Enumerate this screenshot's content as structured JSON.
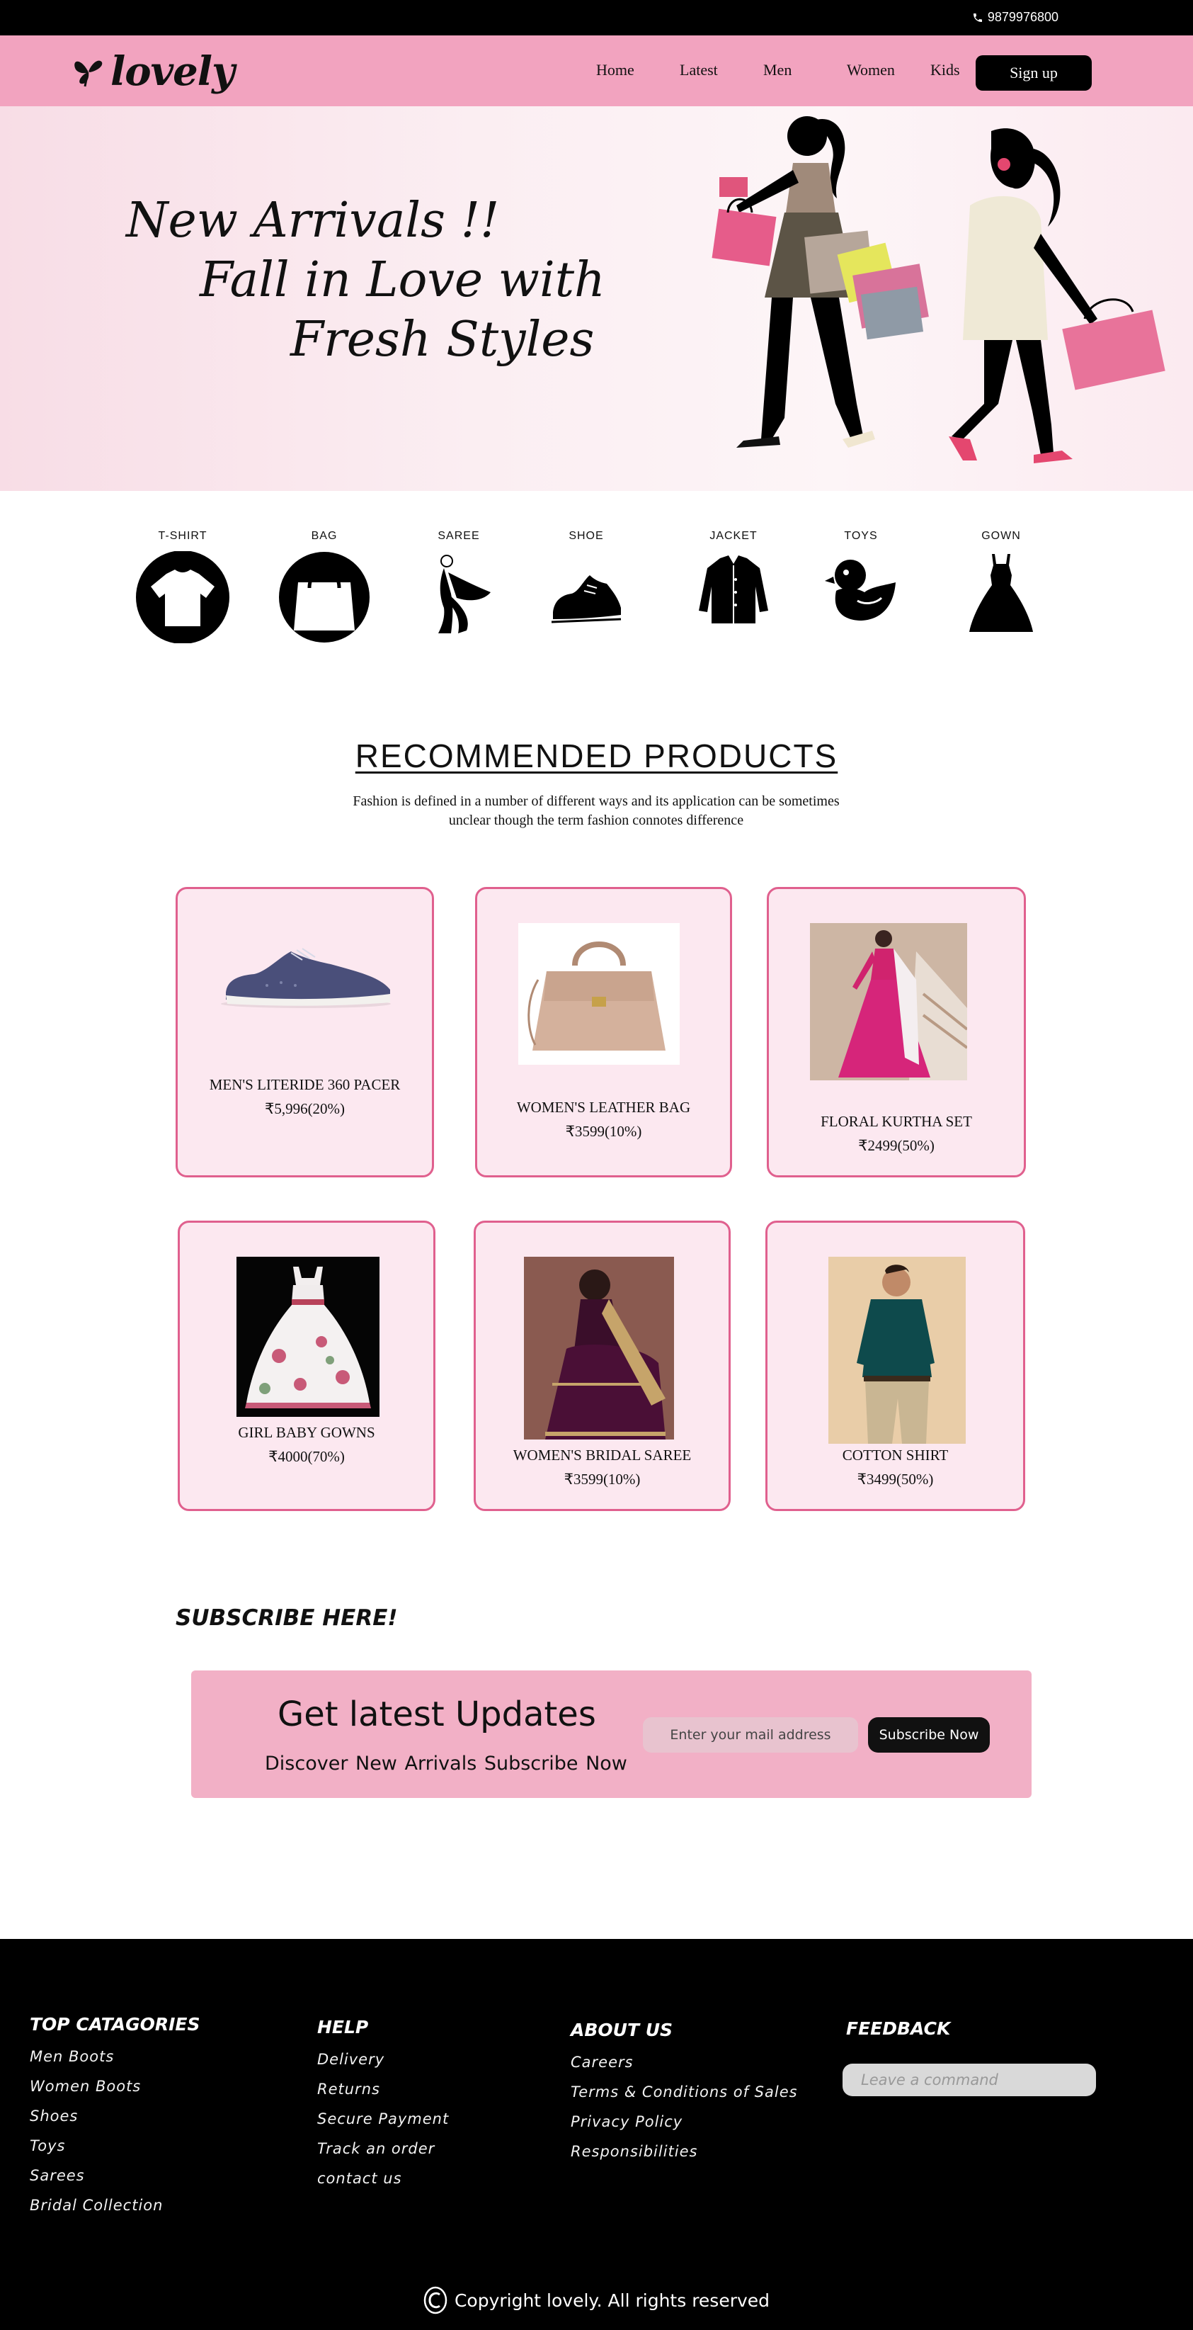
{
  "topbar": {
    "phone": "9879976800"
  },
  "brand": {
    "name": "lovely",
    "pink": "#f2a3bf",
    "card_border": "#e0608e",
    "card_bg": "#fce8f0"
  },
  "nav": {
    "links": [
      "Home",
      "Latest",
      "Men",
      "Women",
      "Kids"
    ],
    "signup": "Sign up"
  },
  "hero": {
    "line1": "New Arrivals !!",
    "line2": "Fall in Love with",
    "line3": "Fresh Styles"
  },
  "categories": [
    {
      "label": "T-SHIRT",
      "icon": "tshirt-icon"
    },
    {
      "label": "BAG",
      "icon": "bag-icon"
    },
    {
      "label": "SAREE",
      "icon": "saree-icon"
    },
    {
      "label": "SHOE",
      "icon": "shoe-icon"
    },
    {
      "label": "JACKET",
      "icon": "jacket-icon"
    },
    {
      "label": "TOYS",
      "icon": "duck-icon"
    },
    {
      "label": "GOWN",
      "icon": "gown-icon"
    }
  ],
  "recommended": {
    "title": "RECOMMENDED PRODUCTS",
    "subtitle": "Fashion is defined in a number of different ways and its application can be sometimes unclear though the term fashion connotes difference",
    "products": [
      {
        "name": "MEN'S LITERIDE 360 PACER",
        "price": "₹5,996(20%)"
      },
      {
        "name": "WOMEN'S LEATHER BAG",
        "price": "₹3599(10%)"
      },
      {
        "name": "FLORAL KURTHA SET",
        "price": "₹2499(50%)"
      },
      {
        "name": "GIRL BABY GOWNS",
        "price": "₹4000(70%)"
      },
      {
        "name": "WOMEN'S BRIDAL SAREE",
        "price": "₹3599(10%)"
      },
      {
        "name": "COTTON SHIRT",
        "price": "₹3499(50%)"
      }
    ]
  },
  "subscribe": {
    "heading": "SUBSCRIBE HERE!",
    "title": "Get latest Updates",
    "line": "Discover New Arrivals  Subscribe Now",
    "placeholder": "Enter your mail address",
    "button": "Subscribe Now"
  },
  "footer": {
    "categories": {
      "title": "TOP CATAGORIES",
      "links": [
        "Men Boots",
        "Women Boots",
        "Shoes",
        "Toys",
        "Sarees",
        "Bridal Collection"
      ]
    },
    "help": {
      "title": "HELP",
      "links": [
        "Delivery",
        "Returns",
        "Secure Payment",
        "Track an order",
        "contact us"
      ]
    },
    "about": {
      "title": "ABOUT US",
      "links": [
        "Careers",
        "Terms & Conditions of Sales",
        "Privacy Policy",
        "Responsibilities"
      ]
    },
    "feedback": {
      "title": "FEEDBACK",
      "placeholder": "Leave a command"
    },
    "copyright": "Copyright lovely. All rights reserved"
  }
}
